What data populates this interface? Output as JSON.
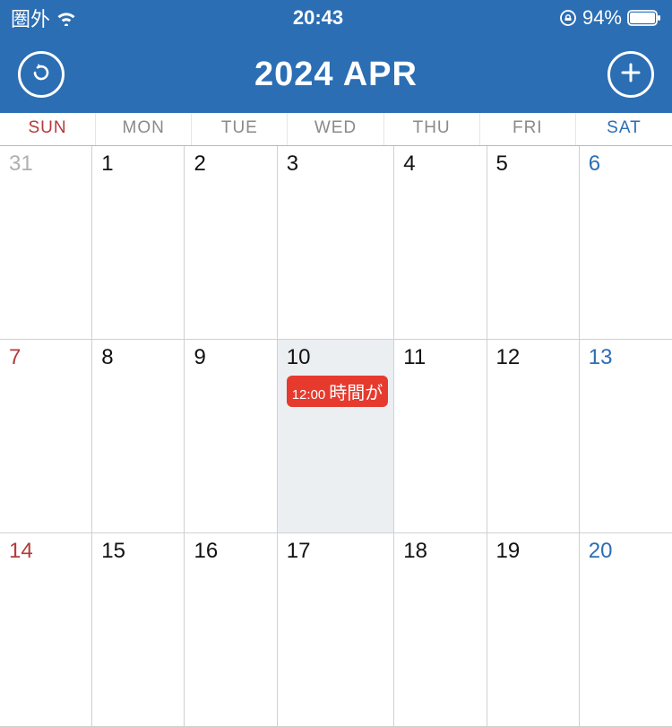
{
  "statusBar": {
    "carrier": "圏外",
    "time": "20:43",
    "batteryPercent": "94%"
  },
  "header": {
    "title": "2024  APR"
  },
  "weekdays": {
    "sun": "SUN",
    "mon": "MON",
    "tue": "TUE",
    "wed": "WED",
    "thu": "THU",
    "fri": "FRI",
    "sat": "SAT"
  },
  "days": {
    "d0": "31",
    "d1": "1",
    "d2": "2",
    "d3": "3",
    "d4": "4",
    "d5": "5",
    "d6": "6",
    "d7": "7",
    "d8": "8",
    "d9": "9",
    "d10": "10",
    "d11": "11",
    "d12": "12",
    "d13": "13",
    "d14": "14",
    "d15": "15",
    "d16": "16",
    "d17": "17",
    "d18": "18",
    "d19": "19",
    "d20": "20"
  },
  "event": {
    "time": "12:00",
    "title": "時間が"
  }
}
